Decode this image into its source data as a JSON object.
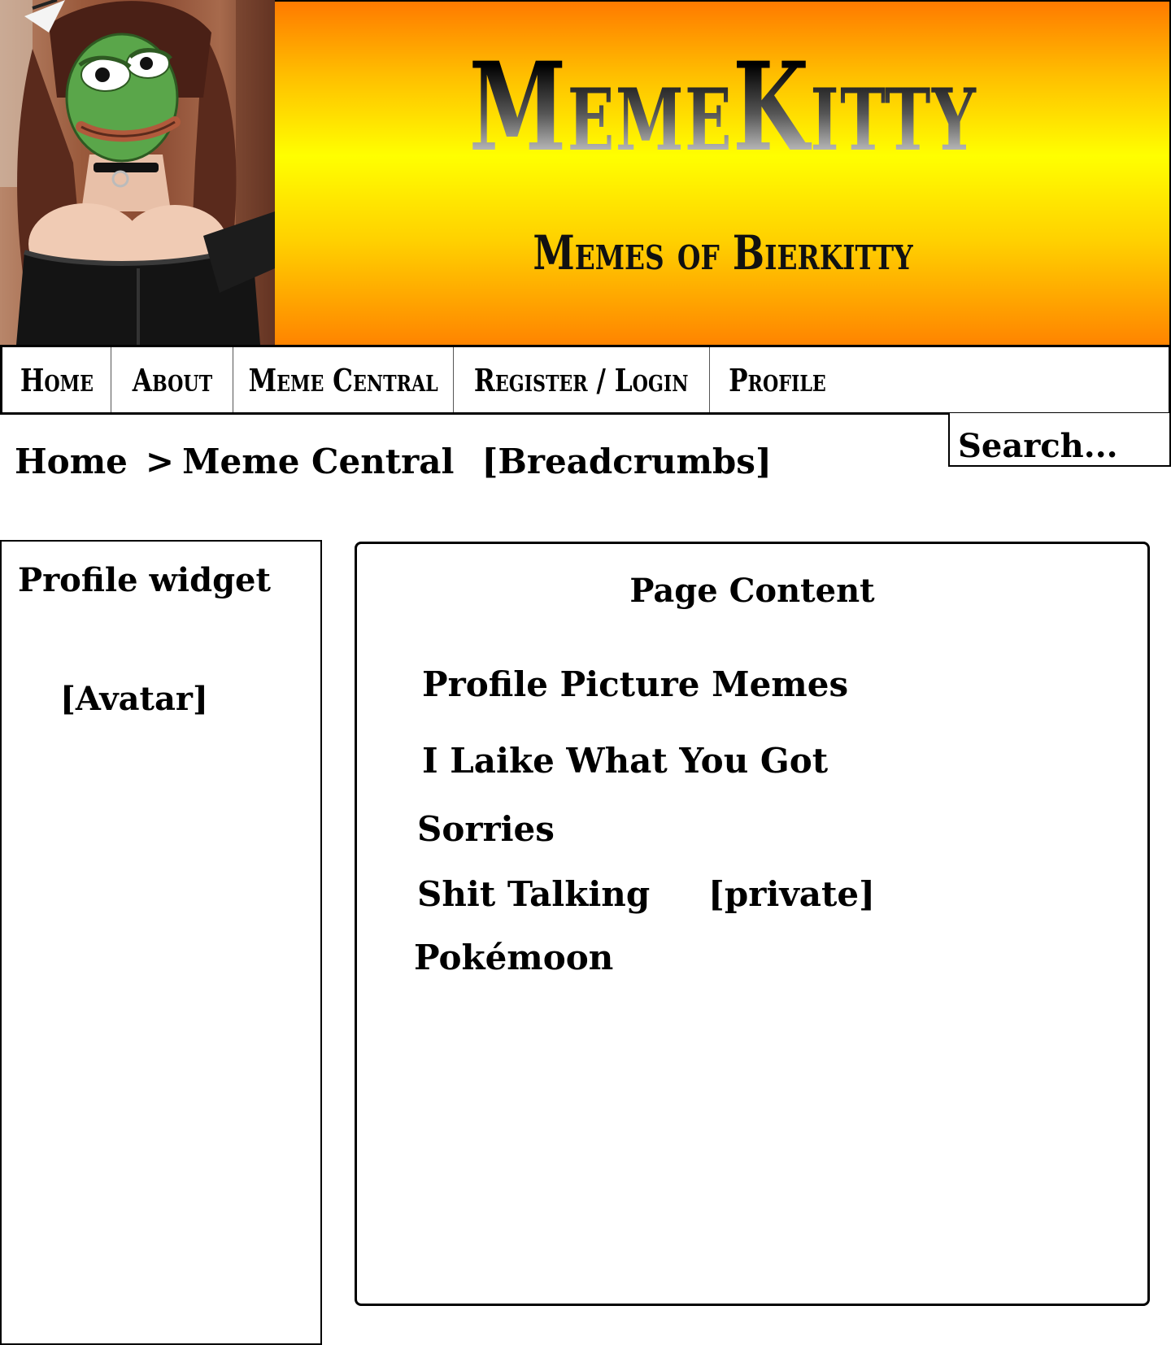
{
  "header": {
    "site_title": "MemeKitty",
    "site_subtitle": "Memes of Bierkitty",
    "colors": {
      "banner_top": "#ff7a00",
      "banner_mid": "#ffff00",
      "banner_bottom": "#ff8400"
    }
  },
  "nav": {
    "items": [
      {
        "label": "Home"
      },
      {
        "label": "About"
      },
      {
        "label": "Meme Central"
      },
      {
        "label": "Register / Login"
      },
      {
        "label": "Profile"
      }
    ]
  },
  "breadcrumb": {
    "home": "Home",
    "separator": ">",
    "current": "Meme Central",
    "note": "[Breadcrumbs]"
  },
  "search": {
    "placeholder": "Search..."
  },
  "sidebar": {
    "title": "Profile widget",
    "avatar_placeholder": "[Avatar]"
  },
  "content": {
    "title": "Page Content",
    "categories": [
      {
        "label": "Profile Picture Memes"
      },
      {
        "label": "I Laike What You Got"
      },
      {
        "label": "Sorries"
      },
      {
        "label": "Shit Talking",
        "tag": "[private]"
      },
      {
        "label": "Pokémoon"
      }
    ]
  }
}
